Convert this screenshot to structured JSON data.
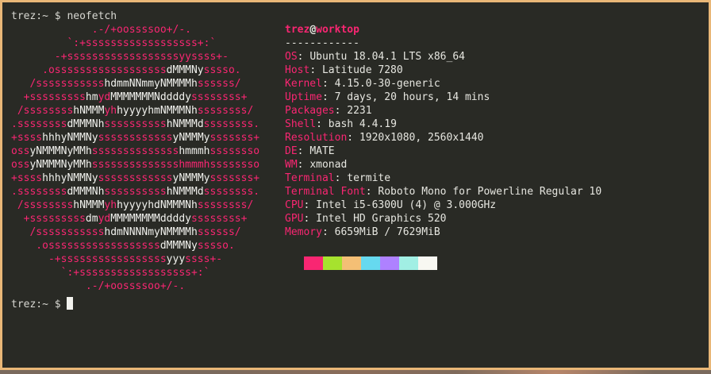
{
  "terminal": {
    "prompt": {
      "user_dir": "trez:~",
      "symbol": "$",
      "command": "neofetch"
    },
    "bottom_prompt": {
      "user_dir": "trez:~",
      "symbol": "$"
    }
  },
  "logo": {
    "rows": [
      [
        [
          "p",
          "             .-/+oossssoo+/-."
        ]
      ],
      [
        [
          "p",
          "         `:+ssssssssssssssssss+:`"
        ]
      ],
      [
        [
          "p",
          "       -+ssssssssssssssssssyyssss+-"
        ]
      ],
      [
        [
          "p",
          "     .ossssssssssssssssss"
        ],
        [
          "w",
          "dMMMNy"
        ],
        [
          "p",
          "sssso."
        ]
      ],
      [
        [
          "p",
          "   /sssssssssss"
        ],
        [
          "w",
          "hdmmNNmmyNMMMMh"
        ],
        [
          "p",
          "ssssss/"
        ]
      ],
      [
        [
          "p",
          "  +sssssssss"
        ],
        [
          "w",
          "hm"
        ],
        [
          "p",
          "yd"
        ],
        [
          "w",
          "MMMMMMMNddddy"
        ],
        [
          "p",
          "ssssssss+"
        ]
      ],
      [
        [
          "p",
          " /ssssssss"
        ],
        [
          "w",
          "hNMMM"
        ],
        [
          "p",
          "yh"
        ],
        [
          "w",
          "hyyyyhmNMMMNh"
        ],
        [
          "p",
          "ssssssss/"
        ]
      ],
      [
        [
          "p",
          ".ssssssss"
        ],
        [
          "w",
          "dMMMNh"
        ],
        [
          "p",
          "ssssssssss"
        ],
        [
          "w",
          "hNMMMd"
        ],
        [
          "p",
          "ssssssss."
        ]
      ],
      [
        [
          "p",
          "+ssss"
        ],
        [
          "w",
          "hhhyNMMNy"
        ],
        [
          "p",
          "ssssssssssss"
        ],
        [
          "w",
          "yNMMMy"
        ],
        [
          "p",
          "sssssss+"
        ]
      ],
      [
        [
          "p",
          "oss"
        ],
        [
          "w",
          "yNMMMNyMMh"
        ],
        [
          "p",
          "ssssssssssssss"
        ],
        [
          "w",
          "hmmmh"
        ],
        [
          "p",
          "ssssssso"
        ]
      ],
      [
        [
          "p",
          "oss"
        ],
        [
          "w",
          "yNMMMNyMMh"
        ],
        [
          "p",
          "sssssssssssssshmmmh"
        ],
        [
          "p",
          "ssssssso"
        ]
      ],
      [
        [
          "p",
          "+ssss"
        ],
        [
          "w",
          "hhhyNMMNy"
        ],
        [
          "p",
          "ssssssssssss"
        ],
        [
          "w",
          "yNMMMy"
        ],
        [
          "p",
          "sssssss+"
        ]
      ],
      [
        [
          "p",
          ".ssssssss"
        ],
        [
          "w",
          "dMMMNh"
        ],
        [
          "p",
          "ssssssssss"
        ],
        [
          "w",
          "hNMMMd"
        ],
        [
          "p",
          "ssssssss."
        ]
      ],
      [
        [
          "p",
          " /ssssssss"
        ],
        [
          "w",
          "hNMMM"
        ],
        [
          "p",
          "yh"
        ],
        [
          "w",
          "hyyyyhdNMMMNh"
        ],
        [
          "p",
          "ssssssss/"
        ]
      ],
      [
        [
          "p",
          "  +sssssssss"
        ],
        [
          "w",
          "dm"
        ],
        [
          "p",
          "yd"
        ],
        [
          "w",
          "MMMMMMMMddddy"
        ],
        [
          "p",
          "ssssssss+"
        ]
      ],
      [
        [
          "p",
          "   /sssssssssss"
        ],
        [
          "w",
          "hdmNNNNmyNMMMMh"
        ],
        [
          "p",
          "ssssss/"
        ]
      ],
      [
        [
          "p",
          "    .ossssssssssssssssss"
        ],
        [
          "w",
          "dMMMNy"
        ],
        [
          "p",
          "sssso."
        ]
      ],
      [
        [
          "p",
          "      -+sssssssssssssssss"
        ],
        [
          "w",
          "yyy"
        ],
        [
          "p",
          "ssss+-"
        ]
      ],
      [
        [
          "p",
          "        `:+ssssssssssssssssss+:`"
        ]
      ],
      [
        [
          "p",
          "            .-/+oossssoo+/-."
        ]
      ]
    ]
  },
  "info": {
    "title_user": "trez",
    "title_at": "@",
    "title_host": "worktop",
    "separator": "------------",
    "items": [
      {
        "key": "OS",
        "value": "Ubuntu 18.04.1 LTS x86_64"
      },
      {
        "key": "Host",
        "value": "Latitude 7280"
      },
      {
        "key": "Kernel",
        "value": "4.15.0-30-generic"
      },
      {
        "key": "Uptime",
        "value": "7 days, 20 hours, 14 mins"
      },
      {
        "key": "Packages",
        "value": "2231"
      },
      {
        "key": "Shell",
        "value": "bash 4.4.19"
      },
      {
        "key": "Resolution",
        "value": "1920x1080, 2560x1440"
      },
      {
        "key": "DE",
        "value": "MATE"
      },
      {
        "key": "WM",
        "value": "xmonad"
      },
      {
        "key": "Terminal",
        "value": "termite"
      },
      {
        "key": "Terminal Font",
        "value": "Roboto Mono for Powerline Regular 10"
      },
      {
        "key": "CPU",
        "value": "Intel i5-6300U (4) @ 3.000GHz"
      },
      {
        "key": "GPU",
        "value": "Intel HD Graphics 520"
      },
      {
        "key": "Memory",
        "value": "6659MiB / 7629MiB"
      }
    ]
  },
  "palette": [
    "#f92672",
    "#a6e22e",
    "#f4bf75",
    "#66d9ef",
    "#ae81ff",
    "#a1efe4",
    "#f8f8f2"
  ],
  "colors": {
    "accent": "#f92672",
    "foreground": "#d8d8d2",
    "background": "#292a25",
    "frame": "#e9b777"
  }
}
